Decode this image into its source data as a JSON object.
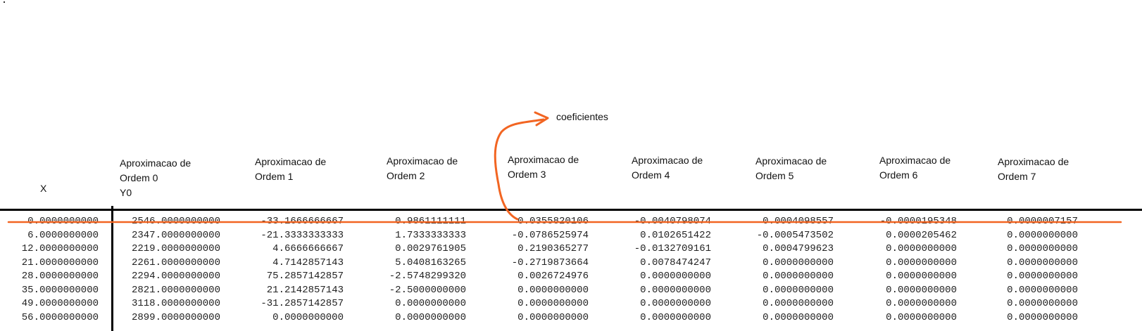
{
  "annotation": {
    "label": "coeficientes",
    "color": "#f26522"
  },
  "headers": [
    {
      "id": "x",
      "lines": [
        "X"
      ]
    },
    {
      "id": "o0",
      "lines": [
        "Aproximacao de",
        "Ordem 0",
        "Y0"
      ]
    },
    {
      "id": "o1",
      "lines": [
        "Aproximacao de",
        "Ordem 1"
      ]
    },
    {
      "id": "o2",
      "lines": [
        "Aproximacao de",
        "Ordem 2"
      ]
    },
    {
      "id": "o3",
      "lines": [
        "Aproximacao de",
        "Ordem 3"
      ]
    },
    {
      "id": "o4",
      "lines": [
        "Aproximacao de",
        "Ordem 4"
      ]
    },
    {
      "id": "o5",
      "lines": [
        "Aproximacao de",
        "Ordem 5"
      ]
    },
    {
      "id": "o6",
      "lines": [
        "Aproximacao de",
        "Ordem 6"
      ]
    },
    {
      "id": "o7",
      "lines": [
        "Aproximacao de",
        "Ordem 7"
      ]
    }
  ],
  "columns": [
    [
      "0.0000000000",
      "6.0000000000",
      "12.0000000000",
      "21.0000000000",
      "28.0000000000",
      "35.0000000000",
      "49.0000000000",
      "56.0000000000"
    ],
    [
      "2546.0000000000",
      "2347.0000000000",
      "2219.0000000000",
      "2261.0000000000",
      "2294.0000000000",
      "2821.0000000000",
      "3118.0000000000",
      "2899.0000000000"
    ],
    [
      "-33.1666666667",
      "-21.3333333333",
      "4.6666666667",
      "4.7142857143",
      "75.2857142857",
      "21.2142857143",
      "-31.2857142857",
      "0.0000000000"
    ],
    [
      "0.9861111111",
      "1.7333333333",
      "0.0029761905",
      "5.0408163265",
      "-2.5748299320",
      "-2.5000000000",
      "0.0000000000",
      "0.0000000000"
    ],
    [
      "0.0355820106",
      "-0.0786525974",
      "0.2190365277",
      "-0.2719873664",
      "0.0026724976",
      "0.0000000000",
      "0.0000000000",
      "0.0000000000"
    ],
    [
      "-0.0040798074",
      "0.0102651422",
      "-0.0132709161",
      "0.0078474247",
      "0.0000000000",
      "0.0000000000",
      "0.0000000000",
      "0.0000000000"
    ],
    [
      "0.0004098557",
      "-0.0005473502",
      "0.0004799623",
      "0.0000000000",
      "0.0000000000",
      "0.0000000000",
      "0.0000000000",
      "0.0000000000"
    ],
    [
      "-0.0000195348",
      "0.0000205462",
      "0.0000000000",
      "0.0000000000",
      "0.0000000000",
      "0.0000000000",
      "0.0000000000",
      "0.0000000000"
    ],
    [
      "0.0000007157",
      "0.0000000000",
      "0.0000000000",
      "0.0000000000",
      "0.0000000000",
      "0.0000000000",
      "0.0000000000",
      "0.0000000000"
    ]
  ]
}
